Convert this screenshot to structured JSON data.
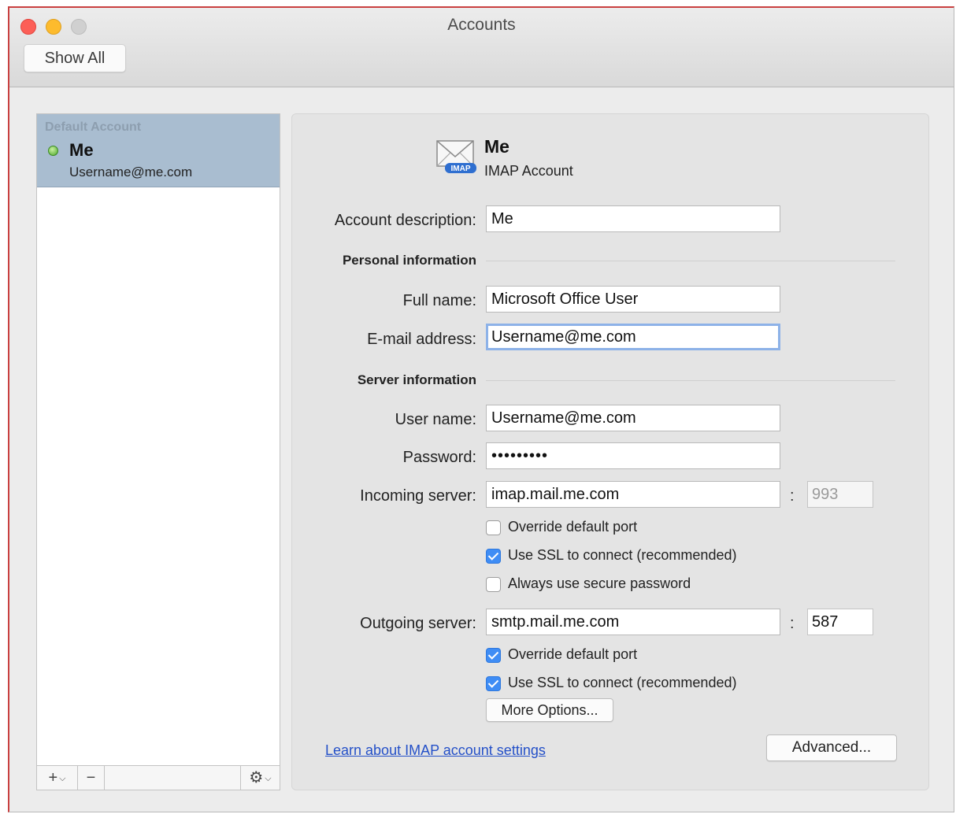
{
  "window": {
    "title": "Accounts",
    "show_all_label": "Show All"
  },
  "sidebar": {
    "group_label": "Default Account",
    "account_name": "Me",
    "account_email": "Username@me.com",
    "status_color": "#4fa82d",
    "toolbar": {
      "add": "+",
      "remove": "−",
      "gear": "⚙"
    }
  },
  "header": {
    "name": "Me",
    "type": "IMAP Account",
    "icon_badge": "IMAP"
  },
  "form": {
    "account_description": {
      "label": "Account description:",
      "value": "Me"
    },
    "personal_section": "Personal information",
    "full_name": {
      "label": "Full name:",
      "value": "Microsoft Office User"
    },
    "email": {
      "label": "E-mail address:",
      "value": "Username@me.com"
    },
    "server_section": "Server information",
    "user_name": {
      "label": "User name:",
      "value": "Username@me.com"
    },
    "password": {
      "label": "Password:",
      "value": "•••••••••"
    },
    "incoming": {
      "label": "Incoming server:",
      "value": "imap.mail.me.com",
      "port": "993",
      "override_port": {
        "label": "Override default port",
        "checked": false
      },
      "use_ssl": {
        "label": "Use SSL to connect (recommended)",
        "checked": true
      },
      "secure_password": {
        "label": "Always use secure password",
        "checked": false
      }
    },
    "outgoing": {
      "label": "Outgoing server:",
      "value": "smtp.mail.me.com",
      "port": "587",
      "override_port": {
        "label": "Override default port",
        "checked": true
      },
      "use_ssl": {
        "label": "Use SSL to connect (recommended)",
        "checked": true
      }
    },
    "colon": ":",
    "more_options_label": "More Options...",
    "advanced_label": "Advanced...",
    "learn_link": "Learn about IMAP account settings"
  },
  "colors": {
    "selection": "#a9bdd0",
    "checkbox_on": "#3f8df5",
    "link": "#2450c8",
    "focus_ring": "#8db2e8"
  }
}
